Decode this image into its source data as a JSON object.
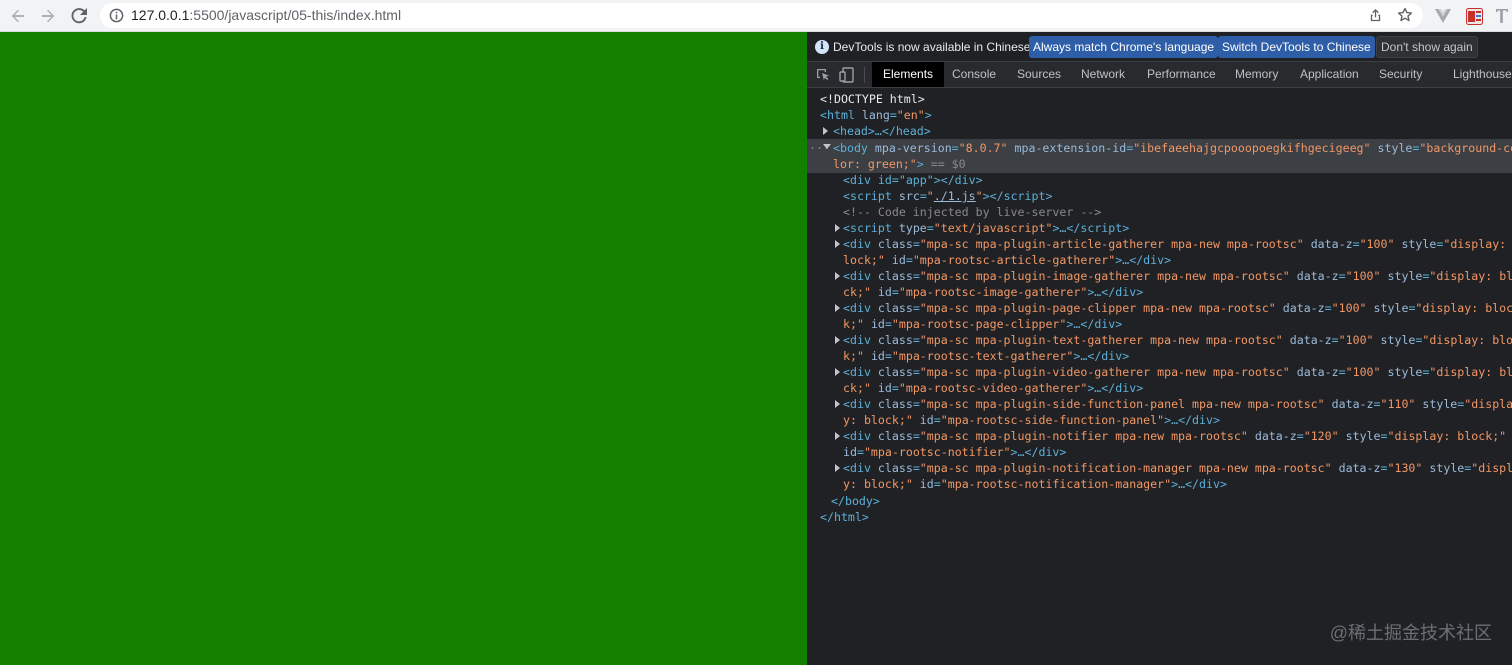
{
  "browser": {
    "url_host": "127.0.0.1",
    "url_rest": ":5500/javascript/05-this/index.html"
  },
  "page": {
    "background": "#148000"
  },
  "devtools": {
    "infobar": {
      "message": "DevTools is now available in Chinese!",
      "btn_match": "Always match Chrome's language",
      "btn_switch": "Switch DevTools to Chinese",
      "btn_dont": "Don't show again"
    },
    "tabs": [
      "Elements",
      "Console",
      "Sources",
      "Network",
      "Performance",
      "Memory",
      "Application",
      "Security",
      "Lighthouse"
    ],
    "tree": {
      "doctype": "<!DOCTYPE html>",
      "html_open": "<html",
      "html_attr": "lang",
      "html_val": "\"en\"",
      "head": "<head>…</head>",
      "body_open": "<body",
      "body_a1": "mpa-version",
      "body_v1": "\"8.0.7\"",
      "body_a2": "mpa-extension-id",
      "body_v2": "\"ibefaeehajgcpooopoegkifhgecigeeg\"",
      "body_a3": "style",
      "body_v3a": "\"background-co",
      "body_v3b": "lor: green;\"",
      "body_eq": "== $0",
      "app_div": "<div id=\"app\"></div>",
      "script1_src": "\"./1.js\"",
      "comment": "<!-- Code injected by live-server -->",
      "script2_type": "\"text/javascript\"",
      "body_close": "</body>",
      "html_close": "</html>",
      "plugins": [
        {
          "cls": "\"mpa-sc mpa-plugin-article-gatherer mpa-new mpa-rootsc\"",
          "z": "\"100\"",
          "st1": "\"display: b",
          "st2": "lock;\"",
          "id": "\"mpa-rootsc-article-gatherer\""
        },
        {
          "cls": "\"mpa-sc mpa-plugin-image-gatherer mpa-new mpa-rootsc\"",
          "z": "\"100\"",
          "st1": "\"display: blo",
          "st2": "ck;\"",
          "id": "\"mpa-rootsc-image-gatherer\""
        },
        {
          "cls": "\"mpa-sc mpa-plugin-page-clipper mpa-new mpa-rootsc\"",
          "z": "\"100\"",
          "st1": "\"display: bloc",
          "st2": "k;\"",
          "id": "\"mpa-rootsc-page-clipper\""
        },
        {
          "cls": "\"mpa-sc mpa-plugin-text-gatherer mpa-new mpa-rootsc\"",
          "z": "\"100\"",
          "st1": "\"display: bloc",
          "st2": "k;\"",
          "id": "\"mpa-rootsc-text-gatherer\""
        },
        {
          "cls": "\"mpa-sc mpa-plugin-video-gatherer mpa-new mpa-rootsc\"",
          "z": "\"100\"",
          "st1": "\"display: blo",
          "st2": "ck;\"",
          "id": "\"mpa-rootsc-video-gatherer\""
        },
        {
          "cls": "\"mpa-sc mpa-plugin-side-function-panel mpa-new mpa-rootsc\"",
          "z": "\"110\"",
          "st1": "\"displa",
          "st2": "y: block;\"",
          "id": "\"mpa-rootsc-side-function-panel\""
        },
        {
          "cls": "\"mpa-sc mpa-plugin-notifier mpa-new mpa-rootsc\"",
          "z": "\"120\"",
          "st1": "\"display: block;\"",
          "st2": "",
          "id": "\"mpa-rootsc-notifier\""
        },
        {
          "cls": "\"mpa-sc mpa-plugin-notification-manager mpa-new mpa-rootsc\"",
          "z": "\"130\"",
          "st1": "\"displa",
          "st2": "y: block;\"",
          "id": "\"mpa-rootsc-notification-manager\""
        }
      ]
    }
  },
  "watermark": "@稀土掘金技术社区"
}
